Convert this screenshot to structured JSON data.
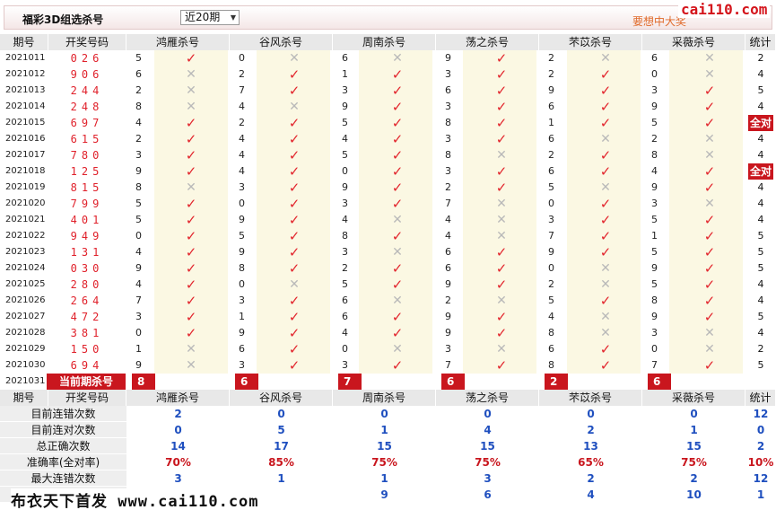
{
  "header": {
    "title": "福彩3D组选杀号",
    "period_select": "近20期",
    "link_text": "要想中大奖",
    "watermark": "cai110.com"
  },
  "columns": {
    "issue": "期号",
    "numbers": "开奖号码",
    "experts": [
      "鸿雁杀号",
      "谷风杀号",
      "周南杀号",
      "荡之杀号",
      "芣苡杀号",
      "采薇杀号"
    ],
    "stats": "统计"
  },
  "rows": [
    {
      "issue": "2021011",
      "nums": "026",
      "picks": [
        [
          "5",
          true
        ],
        [
          "0",
          false
        ],
        [
          "6",
          false
        ],
        [
          "9",
          true
        ],
        [
          "2",
          false
        ],
        [
          "6",
          false
        ]
      ],
      "stat": "2"
    },
    {
      "issue": "2021012",
      "nums": "906",
      "picks": [
        [
          "6",
          false
        ],
        [
          "2",
          true
        ],
        [
          "1",
          true
        ],
        [
          "3",
          true
        ],
        [
          "2",
          true
        ],
        [
          "0",
          false
        ]
      ],
      "stat": "4"
    },
    {
      "issue": "2021013",
      "nums": "244",
      "picks": [
        [
          "2",
          false
        ],
        [
          "7",
          true
        ],
        [
          "3",
          true
        ],
        [
          "6",
          true
        ],
        [
          "9",
          true
        ],
        [
          "3",
          true
        ]
      ],
      "stat": "5"
    },
    {
      "issue": "2021014",
      "nums": "248",
      "picks": [
        [
          "8",
          false
        ],
        [
          "4",
          false
        ],
        [
          "9",
          true
        ],
        [
          "3",
          true
        ],
        [
          "6",
          true
        ],
        [
          "9",
          true
        ]
      ],
      "stat": "4"
    },
    {
      "issue": "2021015",
      "nums": "697",
      "picks": [
        [
          "4",
          true
        ],
        [
          "2",
          true
        ],
        [
          "5",
          true
        ],
        [
          "8",
          true
        ],
        [
          "1",
          true
        ],
        [
          "5",
          true
        ]
      ],
      "stat": "全对"
    },
    {
      "issue": "2021016",
      "nums": "615",
      "picks": [
        [
          "2",
          true
        ],
        [
          "4",
          true
        ],
        [
          "4",
          true
        ],
        [
          "3",
          true
        ],
        [
          "6",
          false
        ],
        [
          "2",
          false
        ]
      ],
      "stat": "4"
    },
    {
      "issue": "2021017",
      "nums": "780",
      "picks": [
        [
          "3",
          true
        ],
        [
          "4",
          true
        ],
        [
          "5",
          true
        ],
        [
          "8",
          false
        ],
        [
          "2",
          true
        ],
        [
          "8",
          false
        ]
      ],
      "stat": "4"
    },
    {
      "issue": "2021018",
      "nums": "125",
      "picks": [
        [
          "9",
          true
        ],
        [
          "4",
          true
        ],
        [
          "0",
          true
        ],
        [
          "3",
          true
        ],
        [
          "6",
          true
        ],
        [
          "4",
          true
        ]
      ],
      "stat": "全对"
    },
    {
      "issue": "2021019",
      "nums": "815",
      "picks": [
        [
          "8",
          false
        ],
        [
          "3",
          true
        ],
        [
          "9",
          true
        ],
        [
          "2",
          true
        ],
        [
          "5",
          false
        ],
        [
          "9",
          true
        ]
      ],
      "stat": "4"
    },
    {
      "issue": "2021020",
      "nums": "799",
      "picks": [
        [
          "5",
          true
        ],
        [
          "0",
          true
        ],
        [
          "3",
          true
        ],
        [
          "7",
          false
        ],
        [
          "0",
          true
        ],
        [
          "3",
          false
        ]
      ],
      "stat": "4"
    },
    {
      "issue": "2021021",
      "nums": "401",
      "picks": [
        [
          "5",
          true
        ],
        [
          "9",
          true
        ],
        [
          "4",
          false
        ],
        [
          "4",
          false
        ],
        [
          "3",
          true
        ],
        [
          "5",
          true
        ]
      ],
      "stat": "4"
    },
    {
      "issue": "2021022",
      "nums": "949",
      "picks": [
        [
          "0",
          true
        ],
        [
          "5",
          true
        ],
        [
          "8",
          true
        ],
        [
          "4",
          false
        ],
        [
          "7",
          true
        ],
        [
          "1",
          true
        ]
      ],
      "stat": "5"
    },
    {
      "issue": "2021023",
      "nums": "131",
      "picks": [
        [
          "4",
          true
        ],
        [
          "9",
          true
        ],
        [
          "3",
          false
        ],
        [
          "6",
          true
        ],
        [
          "9",
          true
        ],
        [
          "5",
          true
        ]
      ],
      "stat": "5"
    },
    {
      "issue": "2021024",
      "nums": "030",
      "picks": [
        [
          "9",
          true
        ],
        [
          "8",
          true
        ],
        [
          "2",
          true
        ],
        [
          "6",
          true
        ],
        [
          "0",
          false
        ],
        [
          "9",
          true
        ]
      ],
      "stat": "5"
    },
    {
      "issue": "2021025",
      "nums": "280",
      "picks": [
        [
          "4",
          true
        ],
        [
          "0",
          false
        ],
        [
          "5",
          true
        ],
        [
          "9",
          true
        ],
        [
          "2",
          false
        ],
        [
          "5",
          true
        ]
      ],
      "stat": "4"
    },
    {
      "issue": "2021026",
      "nums": "264",
      "picks": [
        [
          "7",
          true
        ],
        [
          "3",
          true
        ],
        [
          "6",
          false
        ],
        [
          "2",
          false
        ],
        [
          "5",
          true
        ],
        [
          "8",
          true
        ]
      ],
      "stat": "4"
    },
    {
      "issue": "2021027",
      "nums": "472",
      "picks": [
        [
          "3",
          true
        ],
        [
          "1",
          true
        ],
        [
          "6",
          true
        ],
        [
          "9",
          true
        ],
        [
          "4",
          false
        ],
        [
          "9",
          true
        ]
      ],
      "stat": "5"
    },
    {
      "issue": "2021028",
      "nums": "381",
      "picks": [
        [
          "0",
          true
        ],
        [
          "9",
          true
        ],
        [
          "4",
          true
        ],
        [
          "9",
          true
        ],
        [
          "8",
          false
        ],
        [
          "3",
          false
        ]
      ],
      "stat": "4"
    },
    {
      "issue": "2021029",
      "nums": "150",
      "picks": [
        [
          "1",
          false
        ],
        [
          "6",
          true
        ],
        [
          "0",
          false
        ],
        [
          "3",
          false
        ],
        [
          "6",
          true
        ],
        [
          "0",
          false
        ]
      ],
      "stat": "2"
    },
    {
      "issue": "2021030",
      "nums": "694",
      "picks": [
        [
          "9",
          false
        ],
        [
          "3",
          true
        ],
        [
          "3",
          true
        ],
        [
          "7",
          true
        ],
        [
          "8",
          true
        ],
        [
          "7",
          true
        ]
      ],
      "stat": "5"
    }
  ],
  "current": {
    "issue": "2021031",
    "label": "当前期杀号",
    "picks": [
      "8",
      "6",
      "7",
      "6",
      "2",
      "6"
    ]
  },
  "summary": {
    "rows": [
      {
        "label": "目前连错次数",
        "values": [
          "2",
          "0",
          "0",
          "0",
          "0",
          "0"
        ],
        "total": "12"
      },
      {
        "label": "目前连对次数",
        "values": [
          "0",
          "5",
          "1",
          "4",
          "2",
          "1"
        ],
        "total": "0"
      },
      {
        "label": "总正确次数",
        "values": [
          "14",
          "17",
          "15",
          "15",
          "13",
          "15"
        ],
        "total": "2"
      },
      {
        "label": "准确率(全对率)",
        "values": [
          "70%",
          "85%",
          "75%",
          "75%",
          "65%",
          "75%"
        ],
        "total": "10%"
      },
      {
        "label": "最大连错次数",
        "values": [
          "3",
          "1",
          "1",
          "3",
          "2",
          "2"
        ],
        "total": "12"
      },
      {
        "label": "",
        "values": [
          "",
          "",
          "9",
          "6",
          "4",
          "10"
        ],
        "total": "1"
      }
    ]
  },
  "footer": {
    "banner": "布衣天下首发 www.cai110.com"
  }
}
